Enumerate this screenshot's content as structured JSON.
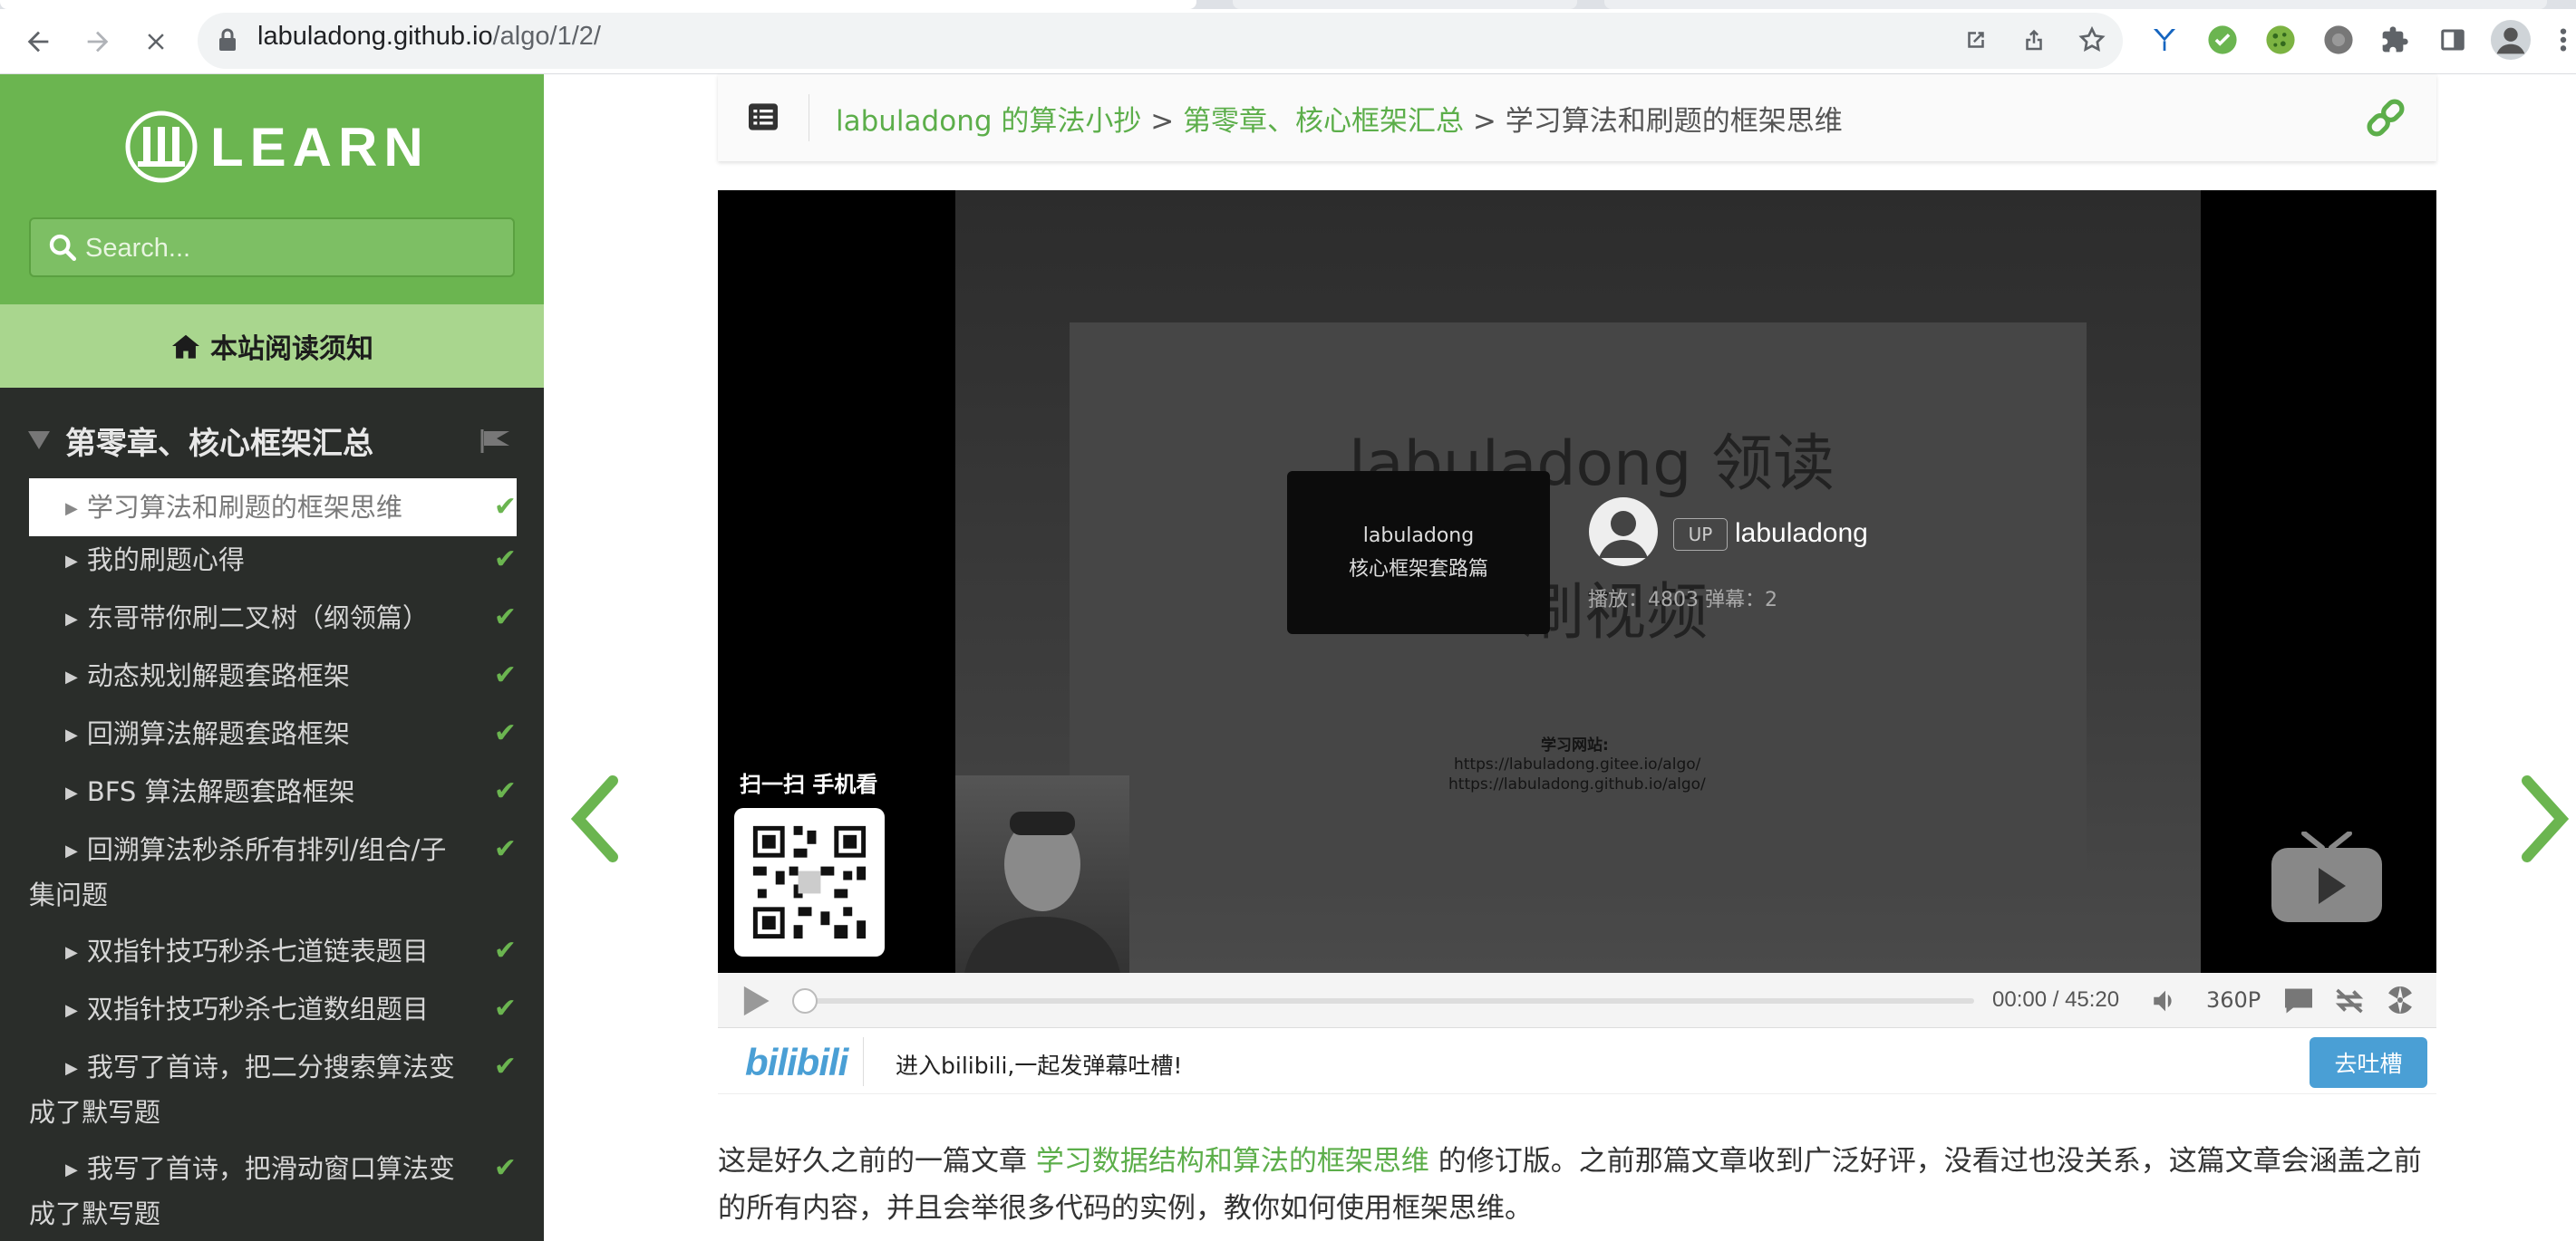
{
  "browser": {
    "url_host": "labuladong.github.io",
    "url_path": "/algo/1/2/"
  },
  "sidebar": {
    "logo_text": "LEARN",
    "search_placeholder": "Search...",
    "notice": "本站阅读须知",
    "chapter": "第零章、核心框架汇总",
    "items": [
      {
        "label": "学习算法和刷题的框架思维",
        "active": true
      },
      {
        "label": "我的刷题心得"
      },
      {
        "label": "东哥带你刷二叉树（纲领篇）"
      },
      {
        "label": "动态规划解题套路框架"
      },
      {
        "label": "回溯算法解题套路框架"
      },
      {
        "label": "BFS 算法解题套路框架"
      },
      {
        "label_1": "回溯算法秒杀所有排列/组合/子",
        "label_2": "集问题"
      },
      {
        "label": "双指针技巧秒杀七道链表题目"
      },
      {
        "label": "双指针技巧秒杀七道数组题目"
      },
      {
        "label_1": "我写了首诗，把二分搜索算法变",
        "label_2": "成了默写题"
      },
      {
        "label_1": "我写了首诗，把滑动窗口算法变",
        "label_2": "成了默写题"
      }
    ]
  },
  "breadcrumb": {
    "part1": "labuladong 的算法小抄",
    "sep1": " > ",
    "part2": "第零章、核心框架汇总",
    "sep2": " > ",
    "current": "学习算法和刷题的框架思维"
  },
  "video": {
    "bg_title": "labuladong 领读",
    "bg_subtitle": "刷视频",
    "card_line1": "labuladong",
    "card_line2": "核心框架套路篇",
    "up_badge": "UP",
    "up_name": "labuladong",
    "stats": "播放：4803    弹幕：2",
    "site_label": "学习网站:",
    "site_url1": "https://labuladong.gitee.io/algo/",
    "site_url2": "https://labuladong.github.io/algo/",
    "qr_label": "扫一扫 手机看",
    "time": "00:00  /  45:20",
    "quality": "360P"
  },
  "bili_bar": {
    "logo": "bilibili",
    "message": "进入bilibili,一起发弹幕吐槽!",
    "button": "去吐槽"
  },
  "paragraph": {
    "before": "这是好久之前的一篇文章 ",
    "link": "学习数据结构和算法的框架思维",
    "after": " 的修订版。之前那篇文章收到广泛好评，没看过也没关系，这篇文章会涵盖之前的所有内容，并且会举很多代码的实例，教你如何使用框架思维。"
  },
  "colors": {
    "accent_green": "#6bb550",
    "link_green": "#5cae4a",
    "sidebar_bg": "#2a2d2a",
    "bili_blue": "#4a9fd5"
  }
}
